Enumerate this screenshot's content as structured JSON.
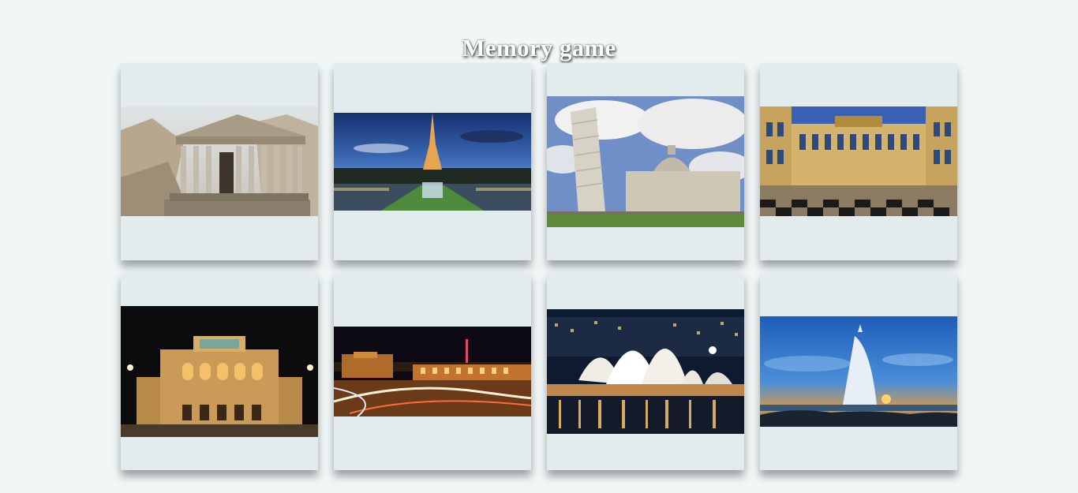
{
  "page": {
    "title": "Memory game"
  },
  "cards": [
    {
      "subject": "temple-of-garni"
    },
    {
      "subject": "eiffel-tower"
    },
    {
      "subject": "leaning-tower-of-pisa"
    },
    {
      "subject": "palace-of-versailles"
    },
    {
      "subject": "vienna-state-opera"
    },
    {
      "subject": "yerevan-republic-square-night"
    },
    {
      "subject": "sydney-opera-house"
    },
    {
      "subject": "burj-al-arab"
    }
  ]
}
